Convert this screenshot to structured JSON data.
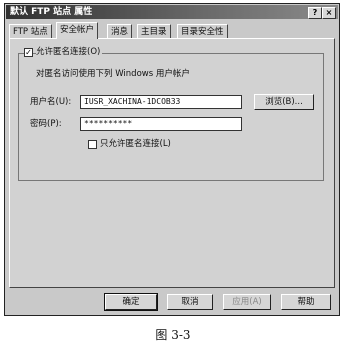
{
  "window": {
    "title": "默认 FTP 站点 属性",
    "help_glyph": "?",
    "close_glyph": "×"
  },
  "tabs": [
    {
      "label": "FTP 站点"
    },
    {
      "label": "安全帐户"
    },
    {
      "label": "消息"
    },
    {
      "label": "主目录"
    },
    {
      "label": "目录安全性"
    }
  ],
  "anonymous": {
    "allow_label": "允许匿名连接(O)",
    "allow_checked": true,
    "description": "对匿名访问使用下列 Windows 用户帐户",
    "username_label": "用户名(U):",
    "username_value": "IUSR_XACHINA-1DCOB33",
    "browse_label": "浏览(B)...",
    "password_label": "密码(P):",
    "password_value": "**********",
    "only_anonymous_label": "只允许匿名连接(L)",
    "only_anonymous_checked": false
  },
  "footer": {
    "ok": "确定",
    "cancel": "取消",
    "apply": "应用(A)",
    "help": "帮助"
  },
  "caption": "图 3-3",
  "checkmark": "✓"
}
